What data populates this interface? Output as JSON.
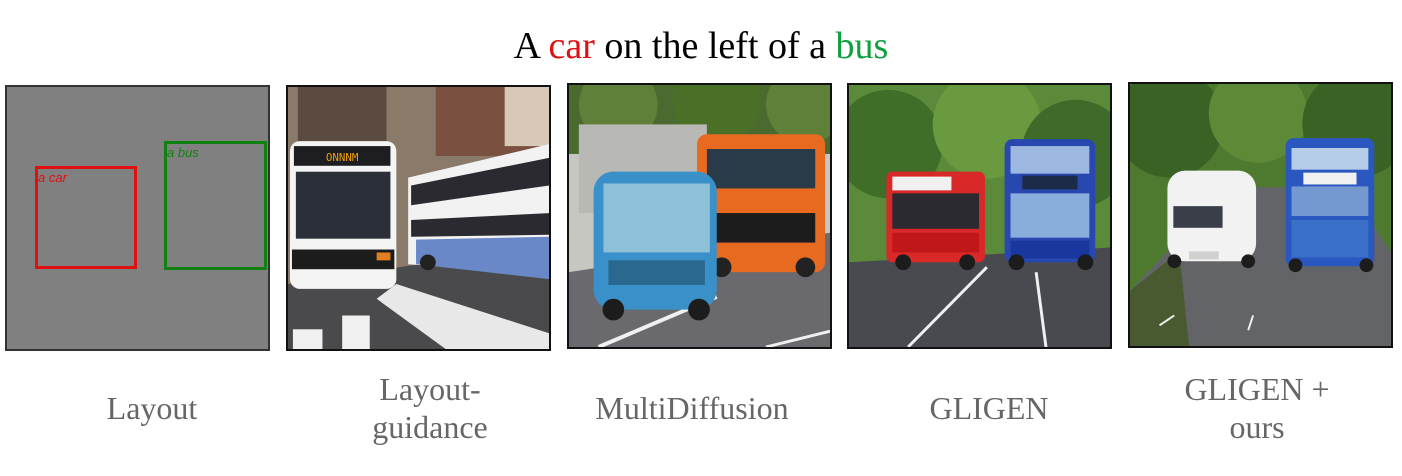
{
  "title": {
    "prefix": "A ",
    "object1": "car",
    "middle": " on the left of a ",
    "object2": "bus",
    "object1_color": "#e01010",
    "object2_color": "#10a040"
  },
  "layout_panel": {
    "background": "#808080",
    "boxes": [
      {
        "label": "a car",
        "color": "#e01010"
      },
      {
        "label": "a bus",
        "color": "#108010"
      }
    ]
  },
  "captions": {
    "layout": "Layout",
    "layout_guidance_1": "Layout-",
    "layout_guidance_2": "guidance",
    "multidiffusion": "MultiDiffusion",
    "gligen": "GLIGEN",
    "gligen_ours_1": "GLIGEN +",
    "gligen_ours_2": "ours"
  }
}
